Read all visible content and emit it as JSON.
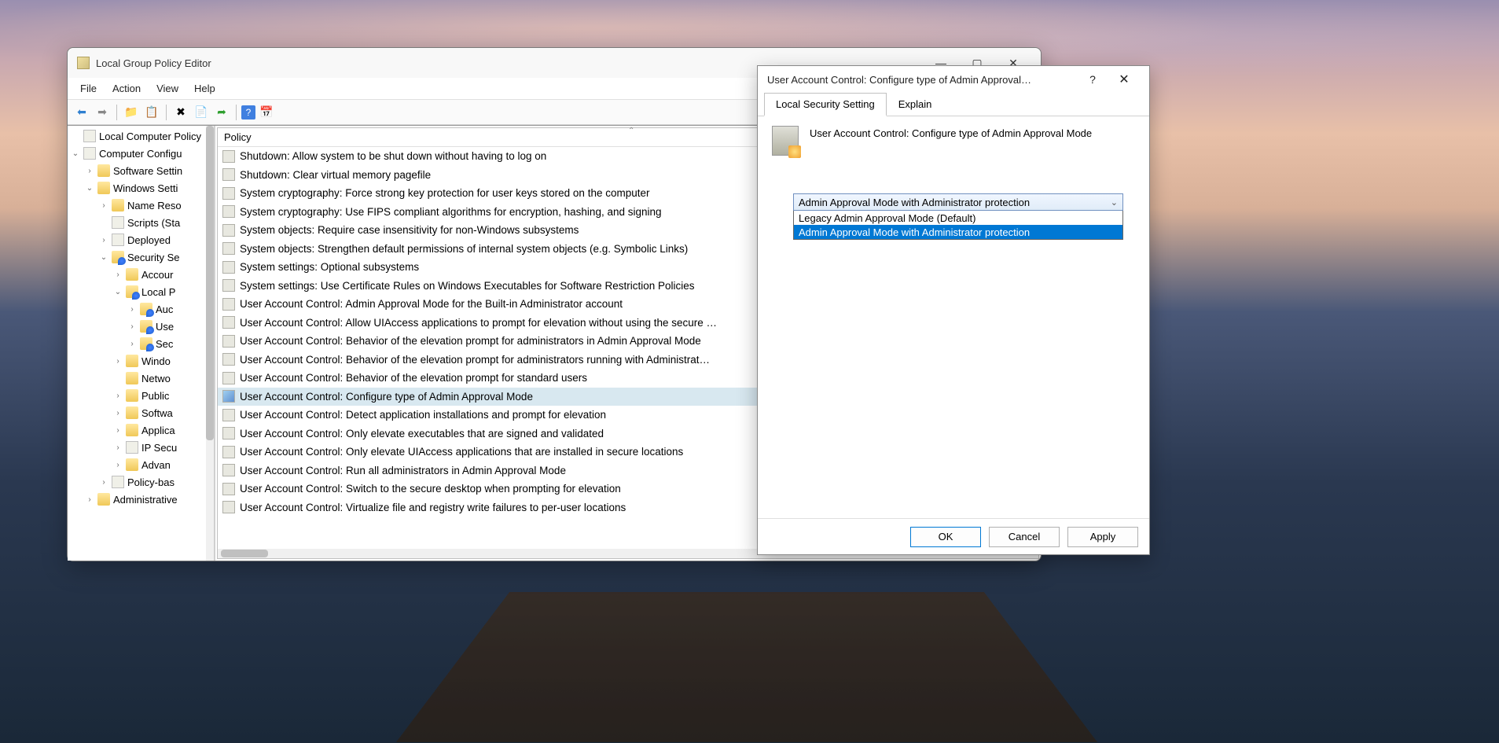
{
  "mainWindow": {
    "title": "Local Group Policy Editor",
    "menu": [
      "File",
      "Action",
      "View",
      "Help"
    ]
  },
  "tree": [
    {
      "indent": 0,
      "arrow": "",
      "icon": "doc",
      "label": "Local Computer Policy"
    },
    {
      "indent": 0,
      "arrow": "v",
      "icon": "pc",
      "label": "Computer Configu"
    },
    {
      "indent": 1,
      "arrow": ">",
      "icon": "folder",
      "label": "Software Settin"
    },
    {
      "indent": 1,
      "arrow": "v",
      "icon": "folder",
      "label": "Windows Setti"
    },
    {
      "indent": 2,
      "arrow": ">",
      "icon": "folder",
      "label": "Name Reso"
    },
    {
      "indent": 2,
      "arrow": "",
      "icon": "script",
      "label": "Scripts (Sta"
    },
    {
      "indent": 2,
      "arrow": ">",
      "icon": "printer",
      "label": "Deployed"
    },
    {
      "indent": 2,
      "arrow": "v",
      "icon": "shield",
      "label": "Security Se"
    },
    {
      "indent": 3,
      "arrow": ">",
      "icon": "folder",
      "label": "Accour"
    },
    {
      "indent": 3,
      "arrow": "v",
      "icon": "shield",
      "label": "Local P"
    },
    {
      "indent": 4,
      "arrow": ">",
      "icon": "shield",
      "label": "Auc"
    },
    {
      "indent": 4,
      "arrow": ">",
      "icon": "shield",
      "label": "Use"
    },
    {
      "indent": 4,
      "arrow": ">",
      "icon": "shield",
      "label": "Sec"
    },
    {
      "indent": 3,
      "arrow": ">",
      "icon": "folder",
      "label": "Windo"
    },
    {
      "indent": 3,
      "arrow": "",
      "icon": "folder",
      "label": "Netwo"
    },
    {
      "indent": 3,
      "arrow": ">",
      "icon": "folder",
      "label": "Public"
    },
    {
      "indent": 3,
      "arrow": ">",
      "icon": "folder",
      "label": "Softwa"
    },
    {
      "indent": 3,
      "arrow": ">",
      "icon": "folder",
      "label": "Applica"
    },
    {
      "indent": 3,
      "arrow": ">",
      "icon": "ipsec",
      "label": "IP Secu"
    },
    {
      "indent": 3,
      "arrow": ">",
      "icon": "folder",
      "label": "Advan"
    },
    {
      "indent": 2,
      "arrow": ">",
      "icon": "chart",
      "label": "Policy-bas"
    },
    {
      "indent": 1,
      "arrow": ">",
      "icon": "folder",
      "label": "Administrative"
    }
  ],
  "listHeader": "Policy",
  "policies": [
    {
      "label": "Shutdown: Allow system to be shut down without having to log on",
      "sel": false
    },
    {
      "label": "Shutdown: Clear virtual memory pagefile",
      "sel": false
    },
    {
      "label": "System cryptography: Force strong key protection for user keys stored on the computer",
      "sel": false
    },
    {
      "label": "System cryptography: Use FIPS compliant algorithms for encryption, hashing, and signing",
      "sel": false
    },
    {
      "label": "System objects: Require case insensitivity for non-Windows subsystems",
      "sel": false
    },
    {
      "label": "System objects: Strengthen default permissions of internal system objects (e.g. Symbolic Links)",
      "sel": false
    },
    {
      "label": "System settings: Optional subsystems",
      "sel": false
    },
    {
      "label": "System settings: Use Certificate Rules on Windows Executables for Software Restriction Policies",
      "sel": false
    },
    {
      "label": "User Account Control: Admin Approval Mode for the Built-in Administrator account",
      "sel": false
    },
    {
      "label": "User Account Control: Allow UIAccess applications to prompt for elevation without using the secure …",
      "sel": false
    },
    {
      "label": "User Account Control: Behavior of the elevation prompt for administrators in Admin Approval Mode",
      "sel": false
    },
    {
      "label": "User Account Control: Behavior of the elevation prompt for administrators running with Administrat…",
      "sel": false
    },
    {
      "label": "User Account Control: Behavior of the elevation prompt for standard users",
      "sel": false
    },
    {
      "label": "User Account Control: Configure type of Admin Approval Mode",
      "sel": true
    },
    {
      "label": "User Account Control: Detect application installations and prompt for elevation",
      "sel": false
    },
    {
      "label": "User Account Control: Only elevate executables that are signed and validated",
      "sel": false
    },
    {
      "label": "User Account Control: Only elevate UIAccess applications that are installed in secure locations",
      "sel": false
    },
    {
      "label": "User Account Control: Run all administrators in Admin Approval Mode",
      "sel": false
    },
    {
      "label": "User Account Control: Switch to the secure desktop when prompting for elevation",
      "sel": false
    },
    {
      "label": "User Account Control: Virtualize file and registry write failures to per-user locations",
      "sel": false
    }
  ],
  "dialog": {
    "title": "User Account Control: Configure type of Admin Approval…",
    "tabs": [
      "Local Security Setting",
      "Explain"
    ],
    "heading": "User Account Control: Configure type of Admin Approval Mode",
    "dropdown": {
      "selected": "Admin Approval Mode with Administrator protection",
      "options": [
        {
          "label": "Legacy Admin Approval Mode (Default)",
          "hl": false
        },
        {
          "label": "Admin Approval Mode with Administrator protection",
          "hl": true
        }
      ]
    },
    "buttons": {
      "ok": "OK",
      "cancel": "Cancel",
      "apply": "Apply"
    }
  }
}
